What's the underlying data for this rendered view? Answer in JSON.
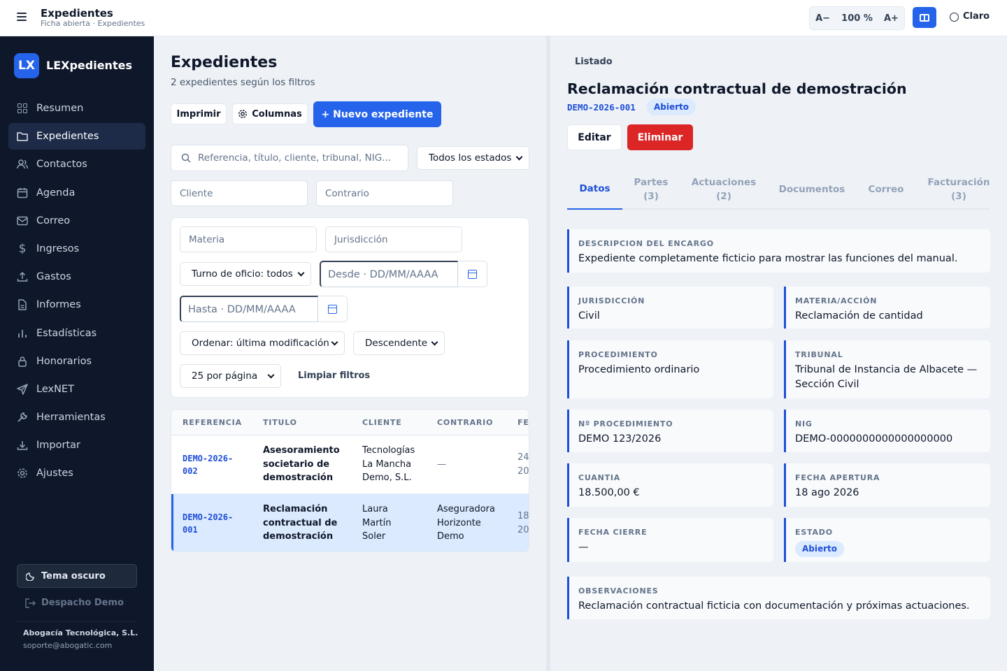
{
  "topbar": {
    "title": "Expedientes",
    "subtitle": "Ficha abierta · Expedientes",
    "zoom_out": "A−",
    "zoom_level": "100 %",
    "zoom_in": "A+",
    "theme_label": "Claro"
  },
  "sidebar": {
    "logo_text": "LX",
    "brand": "LEXpedientes",
    "items": [
      {
        "label": "Resumen",
        "icon": "grid-icon"
      },
      {
        "label": "Expedientes",
        "icon": "folder-icon",
        "active": true
      },
      {
        "label": "Contactos",
        "icon": "users-icon"
      },
      {
        "label": "Agenda",
        "icon": "calendar-icon"
      },
      {
        "label": "Correo",
        "icon": "mail-icon"
      },
      {
        "label": "Ingresos",
        "icon": "dollar-icon"
      },
      {
        "label": "Gastos",
        "icon": "upload-icon"
      },
      {
        "label": "Informes",
        "icon": "file-icon"
      },
      {
        "label": "Estadísticas",
        "icon": "bar-chart-icon"
      },
      {
        "label": "Honorarios",
        "icon": "lock-icon"
      },
      {
        "label": "LexNET",
        "icon": "send-icon"
      },
      {
        "label": "Herramientas",
        "icon": "wrench-icon"
      },
      {
        "label": "Importar",
        "icon": "download-icon"
      },
      {
        "label": "Ajustes",
        "icon": "gear-icon"
      }
    ],
    "dark_theme_label": "Tema oscuro",
    "logout_label": "Despacho Demo",
    "company": "Abogacía Tecnológica, S.L.",
    "support_email": "soporte@abogatic.com"
  },
  "list": {
    "title": "Expedientes",
    "subtitle": "2 expedientes según los filtros",
    "print_label": "Imprimir",
    "columns_label": "Columnas",
    "new_label": "+ Nuevo expediente",
    "search_placeholder": "Referencia, título, cliente, tribunal, NIG...",
    "status_select": "Todos los estados",
    "client_placeholder": "Cliente",
    "opponent_placeholder": "Contrario",
    "subject_placeholder": "Materia",
    "jurisdiction_placeholder": "Jurisdicción",
    "turno_select": "Turno de oficio: todos",
    "from_placeholder": "Desde · DD/MM/AAAA",
    "to_placeholder": "Hasta · DD/MM/AAAA",
    "order_select": "Ordenar: última modificación",
    "direction_select": "Descendente",
    "per_page_select": "25 por página",
    "clear_filters": "Limpiar filtros",
    "columns": [
      "REFERENCIA",
      "TITULO",
      "CLIENTE",
      "CONTRARIO",
      "FE"
    ],
    "rows": [
      {
        "ref": [
          "DEMO-2026-",
          "002"
        ],
        "title": [
          "Asesoramiento",
          "societario de",
          "demostración"
        ],
        "client": [
          "Tecnologías",
          "La Mancha",
          "Demo, S.L."
        ],
        "opponent": [
          "—"
        ],
        "date": [
          "24",
          "20"
        ]
      },
      {
        "ref": [
          "DEMO-2026-",
          "001"
        ],
        "title": [
          "Reclamación",
          "contractual de",
          "demostración"
        ],
        "client": [
          "Laura",
          "Martín",
          "Soler"
        ],
        "opponent": [
          "Aseguradora",
          "Horizonte",
          "Demo"
        ],
        "date": [
          "18",
          "20"
        ],
        "selected": true
      }
    ]
  },
  "detail": {
    "back_label": "Listado",
    "title": "Reclamación contractual de demostración",
    "ref": "DEMO-2026-001",
    "status": "Abierto",
    "edit_label": "Editar",
    "delete_label": "Eliminar",
    "tabs": [
      {
        "label": "Datos",
        "count": ""
      },
      {
        "label": "Partes",
        "count": "(3)"
      },
      {
        "label": "Actuaciones",
        "count": "(2)"
      },
      {
        "label": "Documentos",
        "count": ""
      },
      {
        "label": "Correo",
        "count": ""
      },
      {
        "label": "Facturación",
        "count": "(3)"
      }
    ],
    "fields": {
      "descripcion": {
        "label": "DESCRIPCION DEL ENCARGO",
        "value": "Expediente completamente ficticio para mostrar las funciones del manual."
      },
      "jurisdiccion": {
        "label": "JURISDICCIÓN",
        "value": "Civil"
      },
      "materia": {
        "label": "MATERIA/ACCIÓN",
        "value": "Reclamación de cantidad"
      },
      "procedimiento": {
        "label": "PROCEDIMIENTO",
        "value": "Procedimiento ordinario"
      },
      "tribunal": {
        "label": "TRIBUNAL",
        "value_1": "Tribunal de Instancia de Albacete —",
        "value_2": "Sección Civil"
      },
      "num_procedimiento": {
        "label": "Nº PROCEDIMIENTO",
        "value": "DEMO 123/2026"
      },
      "nig": {
        "label": "NIG",
        "value": "DEMO-0000000000000000000"
      },
      "cuantia": {
        "label": "CUANTIA",
        "value": "18.500,00 €"
      },
      "fecha_apertura": {
        "label": "FECHA APERTURA",
        "value": "18 ago 2026"
      },
      "fecha_cierre": {
        "label": "FECHA CIERRE",
        "value": "—"
      },
      "estado": {
        "label": "ESTADO",
        "value": "Abierto"
      },
      "observaciones": {
        "label": "OBSERVACIONES",
        "value": "Reclamación contractual ficticia con documentación y próximas actuaciones."
      }
    }
  },
  "colors": {
    "accent": "#2563eb",
    "sidebar_bg": "#0f172a",
    "danger": "#dc2626",
    "selected_row": "#dbeafe"
  }
}
